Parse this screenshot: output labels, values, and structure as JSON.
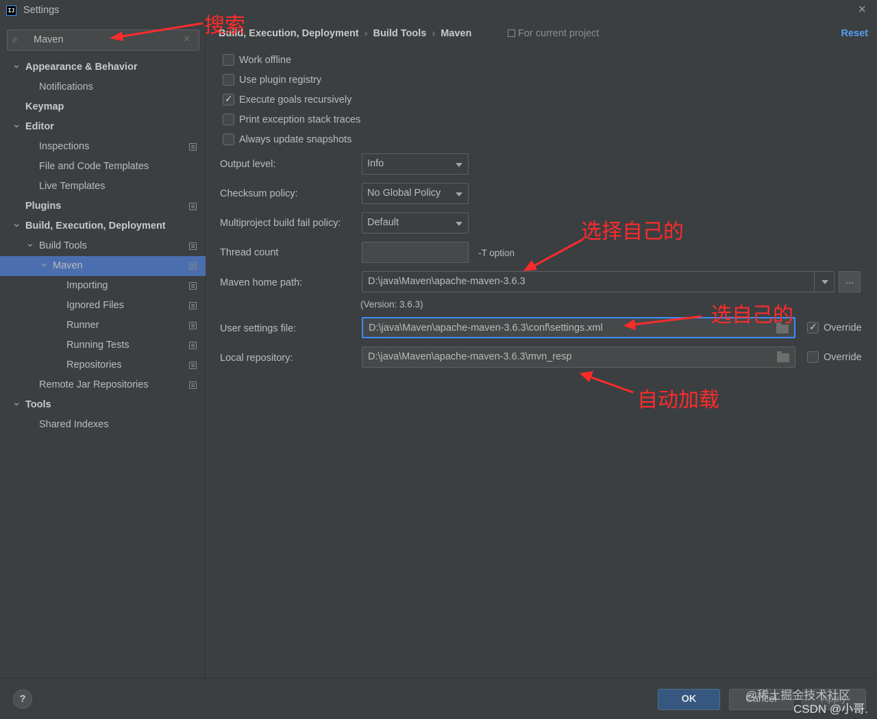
{
  "window": {
    "title": "Settings",
    "app_icon_text": "IJ"
  },
  "search": {
    "value": "Maven"
  },
  "tree": [
    {
      "label": "Appearance & Behavior",
      "level": 0,
      "bold": true,
      "arrow": "expanded",
      "proj": false,
      "selected": false
    },
    {
      "label": "Notifications",
      "level": 1,
      "bold": false,
      "arrow": "none",
      "proj": false,
      "selected": false
    },
    {
      "label": "Keymap",
      "level": 0,
      "bold": true,
      "arrow": "none",
      "proj": false,
      "selected": false
    },
    {
      "label": "Editor",
      "level": 0,
      "bold": true,
      "arrow": "expanded",
      "proj": false,
      "selected": false
    },
    {
      "label": "Inspections",
      "level": 1,
      "bold": false,
      "arrow": "none",
      "proj": true,
      "selected": false
    },
    {
      "label": "File and Code Templates",
      "level": 1,
      "bold": false,
      "arrow": "none",
      "proj": false,
      "selected": false
    },
    {
      "label": "Live Templates",
      "level": 1,
      "bold": false,
      "arrow": "none",
      "proj": false,
      "selected": false
    },
    {
      "label": "Plugins",
      "level": 0,
      "bold": true,
      "arrow": "none",
      "proj": true,
      "selected": false
    },
    {
      "label": "Build, Execution, Deployment",
      "level": 0,
      "bold": true,
      "arrow": "expanded",
      "proj": false,
      "selected": false
    },
    {
      "label": "Build Tools",
      "level": 1,
      "bold": false,
      "arrow": "expanded",
      "proj": true,
      "selected": false
    },
    {
      "label": "Maven",
      "level": 2,
      "bold": false,
      "arrow": "expanded",
      "proj": true,
      "selected": true
    },
    {
      "label": "Importing",
      "level": 3,
      "bold": false,
      "arrow": "none",
      "proj": true,
      "selected": false
    },
    {
      "label": "Ignored Files",
      "level": 3,
      "bold": false,
      "arrow": "none",
      "proj": true,
      "selected": false
    },
    {
      "label": "Runner",
      "level": 3,
      "bold": false,
      "arrow": "none",
      "proj": true,
      "selected": false
    },
    {
      "label": "Running Tests",
      "level": 3,
      "bold": false,
      "arrow": "none",
      "proj": true,
      "selected": false
    },
    {
      "label": "Repositories",
      "level": 3,
      "bold": false,
      "arrow": "none",
      "proj": true,
      "selected": false
    },
    {
      "label": "Remote Jar Repositories",
      "level": 1,
      "bold": false,
      "arrow": "none",
      "proj": true,
      "selected": false
    },
    {
      "label": "Tools",
      "level": 0,
      "bold": true,
      "arrow": "expanded",
      "proj": false,
      "selected": false
    },
    {
      "label": "Shared Indexes",
      "level": 1,
      "bold": false,
      "arrow": "none",
      "proj": false,
      "selected": false
    }
  ],
  "breadcrumb": [
    "Build, Execution, Deployment",
    "Build Tools",
    "Maven"
  ],
  "scope_label": "For current project",
  "reset_label": "Reset",
  "checkboxes": [
    {
      "label": "Work offline",
      "checked": false
    },
    {
      "label": "Use plugin registry",
      "checked": false
    },
    {
      "label": "Execute goals recursively",
      "checked": true
    },
    {
      "label": "Print exception stack traces",
      "checked": false
    },
    {
      "label": "Always update snapshots",
      "checked": false
    }
  ],
  "output_level": {
    "label": "Output level:",
    "value": "Info"
  },
  "checksum_policy": {
    "label": "Checksum policy:",
    "value": "No Global Policy"
  },
  "multiproject_policy": {
    "label": "Multiproject build fail policy:",
    "value": "Default"
  },
  "thread_count": {
    "label": "Thread count",
    "value": "",
    "suffix": "-T option"
  },
  "maven_home": {
    "label": "Maven home path:",
    "value": "D:\\java\\Maven\\apache-maven-3.6.3",
    "browse_label": "...",
    "version": "(Version: 3.6.3)"
  },
  "user_settings": {
    "label": "User settings file:",
    "value": "D:\\java\\Maven\\apache-maven-3.6.3\\conf\\settings.xml",
    "override_label": "Override",
    "override_checked": true
  },
  "local_repo": {
    "label": "Local repository:",
    "value": "D:\\java\\Maven\\apache-maven-3.6.3\\mvn_resp",
    "override_label": "Override",
    "override_checked": false
  },
  "annotations": {
    "search": "搜索",
    "choose_own": "选择自己的",
    "pick_own": "选自己的",
    "auto_load": "自动加载",
    "color": "#ff2b2b"
  },
  "buttons": {
    "help": "?",
    "ok": "OK",
    "cancel": "Cancel",
    "apply": "Apply"
  },
  "watermark": {
    "line1": "@稀土掘金技术社区",
    "line2": "CSDN @小哥."
  },
  "colors": {
    "background": "#3c3f41",
    "selection": "#4b6eaf",
    "link": "#589df6",
    "focus": "#3d8eff"
  }
}
